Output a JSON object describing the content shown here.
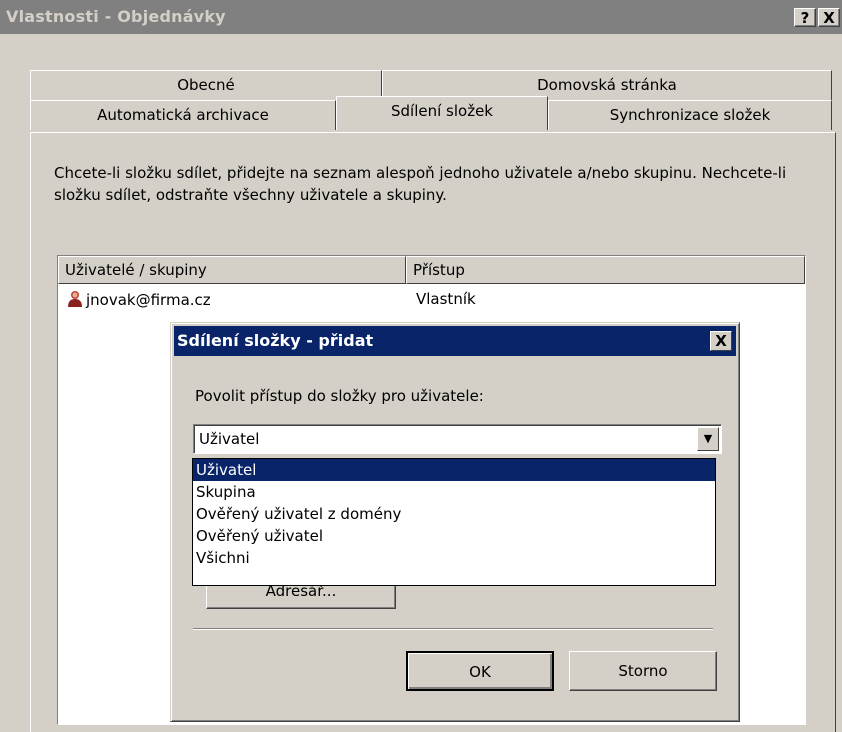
{
  "window": {
    "title": "Vlastnosti - Objednávky",
    "help_button": "?",
    "close_button": "X"
  },
  "tabs": {
    "row1": [
      {
        "label": "Obecné"
      },
      {
        "label": "Domovská stránka"
      }
    ],
    "row2": [
      {
        "label": "Automatická archivace"
      },
      {
        "label": "Sdílení složek",
        "active": true
      },
      {
        "label": "Synchronizace složek"
      }
    ]
  },
  "description": "Chcete-li složku sdílet, přidejte na seznam alespoň jednoho uživatele a/nebo skupinu. Nechcete-li složku sdílet, odstraňte všechny uživatele a skupiny.",
  "table": {
    "columns": [
      "Uživatelé / skupiny",
      "Přístup"
    ],
    "rows": [
      {
        "user": "jnovak@firma.cz",
        "access": "Vlastník",
        "icon": "user-icon"
      }
    ]
  },
  "dialog": {
    "title": "Sdílení složky - přidat",
    "close_button": "X",
    "prompt": "Povolit přístup do složky pro uživatele:",
    "combo_value": "Uživatel",
    "options": [
      {
        "label": "Uživatel",
        "selected": true
      },
      {
        "label": "Skupina"
      },
      {
        "label": "Ověřený uživatel z domény"
      },
      {
        "label": "Ověřený uživatel"
      },
      {
        "label": "Všichni"
      }
    ],
    "address_button": "Adresář...",
    "ok_button": "OK",
    "cancel_button": "Storno"
  },
  "colors": {
    "selection": "#0a246a",
    "face": "#d4d0c8",
    "inactive_title": "#808080"
  }
}
